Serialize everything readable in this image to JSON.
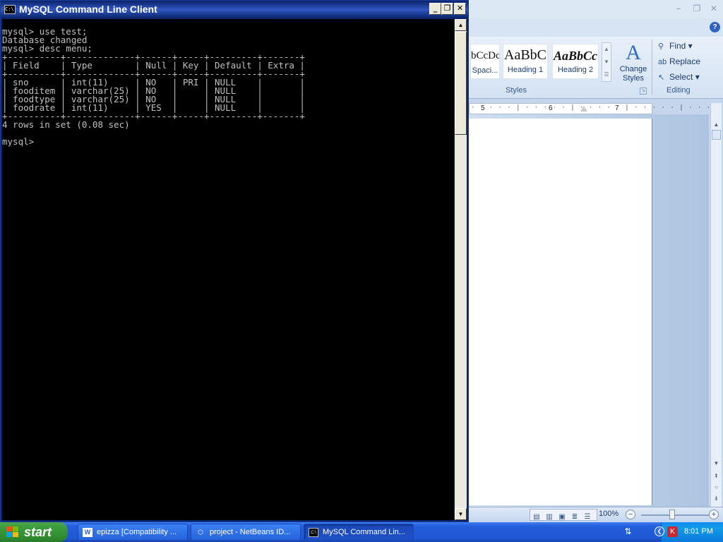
{
  "console": {
    "title": "MySQL Command Line Client",
    "output": "mysql> use test;\nDatabase changed\nmysql> desc menu;\n+----------+-------------+------+-----+---------+-------+\n| Field    | Type        | Null | Key | Default | Extra |\n+----------+-------------+------+-----+---------+-------+\n| sno      | int(11)     | NO   | PRI | NULL    |       |\n| fooditem | varchar(25) | NO   |     | NULL    |       |\n| foodtype | varchar(25) | NO   |     | NULL    |       |\n| foodrate | int(11)     | YES  |     | NULL    |       |\n+----------+-------------+------+-----+---------+-------+\n4 rows in set (0.08 sec)\n\nmysql>",
    "minimize": "_",
    "restore": "❐",
    "close": "✕"
  },
  "word": {
    "styles": [
      {
        "sample": "bCcDc",
        "name": "Spaci..."
      },
      {
        "sample": "AaBbC",
        "name": "Heading 1"
      },
      {
        "sample": "AaBbCc",
        "name": "Heading 2"
      }
    ],
    "change_styles_line1": "Change",
    "change_styles_line2": "Styles",
    "styles_group": "Styles",
    "editing": {
      "find": "Find",
      "replace": "Replace",
      "select": "Select",
      "group": "Editing"
    },
    "ruler_marks": [
      "5",
      "6",
      "7"
    ],
    "zoom": "100%"
  },
  "taskbar": {
    "start": "start",
    "tasks": [
      {
        "label": "epizza [Compatibility ...",
        "icon": "word-icon"
      },
      {
        "label": "project - NetBeans ID...",
        "icon": "netbeans-icon"
      },
      {
        "label": "MySQL Command Lin...",
        "icon": "console-icon"
      }
    ],
    "clock": "8:01 PM"
  },
  "colors": {
    "console_bg": "#000000",
    "console_text": "#c0c0c0",
    "titlebar_active": "#0a246a",
    "taskbar_blue": "#245edb",
    "start_green": "#3a9b3a"
  }
}
